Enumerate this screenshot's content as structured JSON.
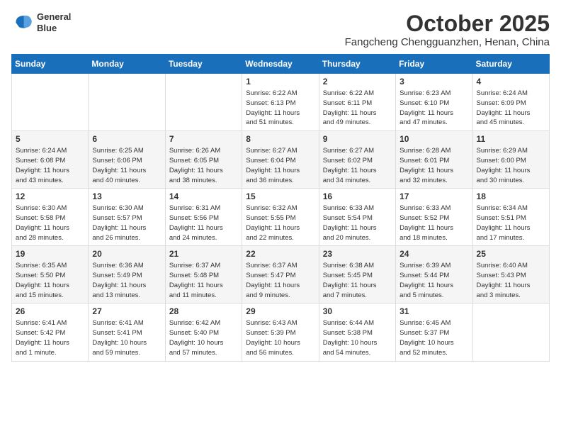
{
  "header": {
    "logo_line1": "General",
    "logo_line2": "Blue",
    "month": "October 2025",
    "location": "Fangcheng Chengguanzhen, Henan, China"
  },
  "weekdays": [
    "Sunday",
    "Monday",
    "Tuesday",
    "Wednesday",
    "Thursday",
    "Friday",
    "Saturday"
  ],
  "weeks": [
    [
      {
        "day": "",
        "info": ""
      },
      {
        "day": "",
        "info": ""
      },
      {
        "day": "",
        "info": ""
      },
      {
        "day": "1",
        "info": "Sunrise: 6:22 AM\nSunset: 6:13 PM\nDaylight: 11 hours\nand 51 minutes."
      },
      {
        "day": "2",
        "info": "Sunrise: 6:22 AM\nSunset: 6:11 PM\nDaylight: 11 hours\nand 49 minutes."
      },
      {
        "day": "3",
        "info": "Sunrise: 6:23 AM\nSunset: 6:10 PM\nDaylight: 11 hours\nand 47 minutes."
      },
      {
        "day": "4",
        "info": "Sunrise: 6:24 AM\nSunset: 6:09 PM\nDaylight: 11 hours\nand 45 minutes."
      }
    ],
    [
      {
        "day": "5",
        "info": "Sunrise: 6:24 AM\nSunset: 6:08 PM\nDaylight: 11 hours\nand 43 minutes."
      },
      {
        "day": "6",
        "info": "Sunrise: 6:25 AM\nSunset: 6:06 PM\nDaylight: 11 hours\nand 40 minutes."
      },
      {
        "day": "7",
        "info": "Sunrise: 6:26 AM\nSunset: 6:05 PM\nDaylight: 11 hours\nand 38 minutes."
      },
      {
        "day": "8",
        "info": "Sunrise: 6:27 AM\nSunset: 6:04 PM\nDaylight: 11 hours\nand 36 minutes."
      },
      {
        "day": "9",
        "info": "Sunrise: 6:27 AM\nSunset: 6:02 PM\nDaylight: 11 hours\nand 34 minutes."
      },
      {
        "day": "10",
        "info": "Sunrise: 6:28 AM\nSunset: 6:01 PM\nDaylight: 11 hours\nand 32 minutes."
      },
      {
        "day": "11",
        "info": "Sunrise: 6:29 AM\nSunset: 6:00 PM\nDaylight: 11 hours\nand 30 minutes."
      }
    ],
    [
      {
        "day": "12",
        "info": "Sunrise: 6:30 AM\nSunset: 5:58 PM\nDaylight: 11 hours\nand 28 minutes."
      },
      {
        "day": "13",
        "info": "Sunrise: 6:30 AM\nSunset: 5:57 PM\nDaylight: 11 hours\nand 26 minutes."
      },
      {
        "day": "14",
        "info": "Sunrise: 6:31 AM\nSunset: 5:56 PM\nDaylight: 11 hours\nand 24 minutes."
      },
      {
        "day": "15",
        "info": "Sunrise: 6:32 AM\nSunset: 5:55 PM\nDaylight: 11 hours\nand 22 minutes."
      },
      {
        "day": "16",
        "info": "Sunrise: 6:33 AM\nSunset: 5:54 PM\nDaylight: 11 hours\nand 20 minutes."
      },
      {
        "day": "17",
        "info": "Sunrise: 6:33 AM\nSunset: 5:52 PM\nDaylight: 11 hours\nand 18 minutes."
      },
      {
        "day": "18",
        "info": "Sunrise: 6:34 AM\nSunset: 5:51 PM\nDaylight: 11 hours\nand 17 minutes."
      }
    ],
    [
      {
        "day": "19",
        "info": "Sunrise: 6:35 AM\nSunset: 5:50 PM\nDaylight: 11 hours\nand 15 minutes."
      },
      {
        "day": "20",
        "info": "Sunrise: 6:36 AM\nSunset: 5:49 PM\nDaylight: 11 hours\nand 13 minutes."
      },
      {
        "day": "21",
        "info": "Sunrise: 6:37 AM\nSunset: 5:48 PM\nDaylight: 11 hours\nand 11 minutes."
      },
      {
        "day": "22",
        "info": "Sunrise: 6:37 AM\nSunset: 5:47 PM\nDaylight: 11 hours\nand 9 minutes."
      },
      {
        "day": "23",
        "info": "Sunrise: 6:38 AM\nSunset: 5:45 PM\nDaylight: 11 hours\nand 7 minutes."
      },
      {
        "day": "24",
        "info": "Sunrise: 6:39 AM\nSunset: 5:44 PM\nDaylight: 11 hours\nand 5 minutes."
      },
      {
        "day": "25",
        "info": "Sunrise: 6:40 AM\nSunset: 5:43 PM\nDaylight: 11 hours\nand 3 minutes."
      }
    ],
    [
      {
        "day": "26",
        "info": "Sunrise: 6:41 AM\nSunset: 5:42 PM\nDaylight: 11 hours\nand 1 minute."
      },
      {
        "day": "27",
        "info": "Sunrise: 6:41 AM\nSunset: 5:41 PM\nDaylight: 10 hours\nand 59 minutes."
      },
      {
        "day": "28",
        "info": "Sunrise: 6:42 AM\nSunset: 5:40 PM\nDaylight: 10 hours\nand 57 minutes."
      },
      {
        "day": "29",
        "info": "Sunrise: 6:43 AM\nSunset: 5:39 PM\nDaylight: 10 hours\nand 56 minutes."
      },
      {
        "day": "30",
        "info": "Sunrise: 6:44 AM\nSunset: 5:38 PM\nDaylight: 10 hours\nand 54 minutes."
      },
      {
        "day": "31",
        "info": "Sunrise: 6:45 AM\nSunset: 5:37 PM\nDaylight: 10 hours\nand 52 minutes."
      },
      {
        "day": "",
        "info": ""
      }
    ]
  ]
}
